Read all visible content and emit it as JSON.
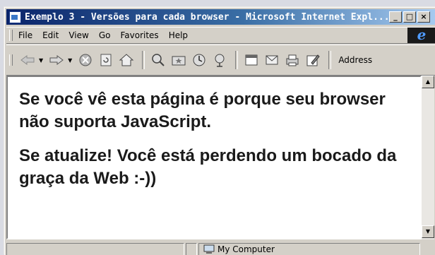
{
  "window": {
    "title": "Exemplo 3 - Versões para cada browser - Microsoft Internet Expl...",
    "controls": {
      "minimize": "_",
      "maximize": "□",
      "close": "×"
    }
  },
  "menu": {
    "items": [
      "File",
      "Edit",
      "View",
      "Go",
      "Favorites",
      "Help"
    ]
  },
  "toolbar": {
    "address_label": "Address",
    "icons": [
      "back-icon",
      "forward-icon",
      "stop-icon",
      "refresh-icon",
      "home-icon",
      "search-icon",
      "favorites-icon",
      "history-icon",
      "channels-icon",
      "fullscreen-icon",
      "mail-icon",
      "print-icon",
      "edit-icon"
    ]
  },
  "content": {
    "paragraph1": "Se você vê esta página é porque seu browser não suporta JavaScript.",
    "paragraph2": "Se atualize! Você está perdendo um bocado da graça da Web :-))"
  },
  "status": {
    "zone": "My Computer"
  },
  "colors": {
    "titlebar_start": "#0a246a",
    "titlebar_end": "#a6caf0",
    "chrome": "#d4d0c8"
  }
}
